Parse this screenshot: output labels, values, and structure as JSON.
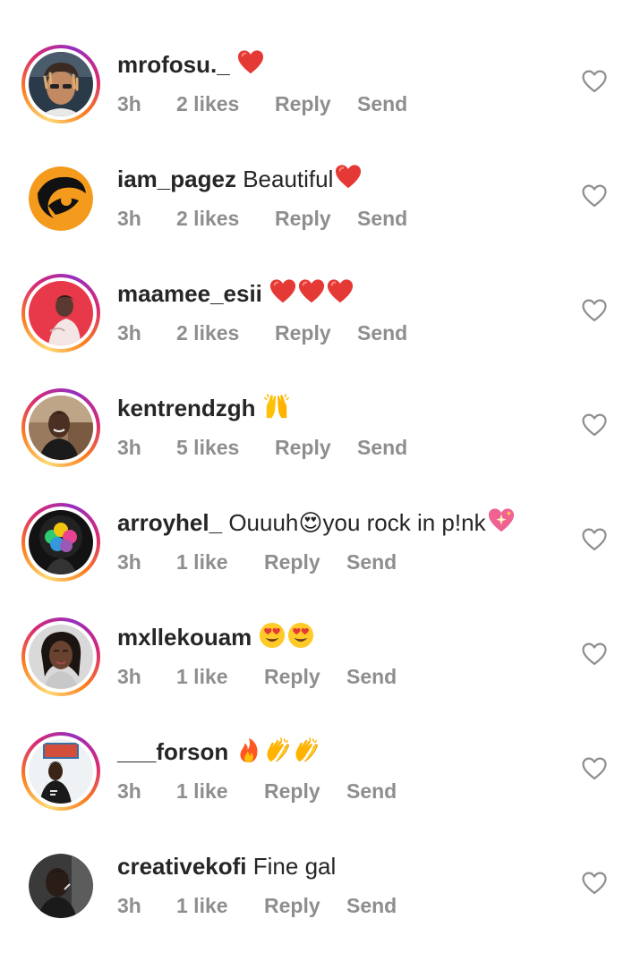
{
  "comments": [
    {
      "username": "mrofosu._",
      "text": "",
      "emojis": [
        "red-heart"
      ],
      "time": "3h",
      "likes": "2 likes",
      "reply": "Reply",
      "send": "Send",
      "avatar": "selfie-car",
      "ring": true
    },
    {
      "username": "iam_pagez",
      "text": "Beautiful",
      "emojis": [
        "red-heart"
      ],
      "time": "3h",
      "likes": "2 likes",
      "reply": "Reply",
      "send": "Send",
      "avatar": "orange-logo",
      "ring": false
    },
    {
      "username": "maamee_esii",
      "text": "",
      "emojis": [
        "red-heart",
        "red-heart",
        "red-heart"
      ],
      "time": "3h",
      "likes": "2 likes",
      "reply": "Reply",
      "send": "Send",
      "avatar": "red-portrait",
      "ring": true
    },
    {
      "username": "kentrendzgh",
      "text": "",
      "emojis": [
        "raising-hands"
      ],
      "time": "3h",
      "likes": "5 likes",
      "reply": "Reply",
      "send": "Send",
      "avatar": "man-portrait",
      "ring": true
    },
    {
      "username": "arroyhel_",
      "text": "Ouuuh😍you rock in p!nk",
      "emojis": [
        "sparkling-heart"
      ],
      "time": "3h",
      "likes": "1 like",
      "reply": "Reply",
      "send": "Send",
      "avatar": "rainbow-hair",
      "ring": true
    },
    {
      "username": "mxllekouam",
      "text": "",
      "emojis": [
        "heart-eyes",
        "heart-eyes"
      ],
      "time": "3h",
      "likes": "1 like",
      "reply": "Reply",
      "send": "Send",
      "avatar": "woman-portrait",
      "ring": true
    },
    {
      "username": "___forson",
      "text": "",
      "emojis": [
        "fire",
        "clapping-hands",
        "clapping-hands"
      ],
      "time": "3h",
      "likes": "1 like",
      "reply": "Reply",
      "send": "Send",
      "avatar": "man-room",
      "ring": true
    },
    {
      "username": "creativekofi",
      "text": "Fine gal",
      "emojis": [],
      "time": "3h",
      "likes": "1 like",
      "reply": "Reply",
      "send": "Send",
      "avatar": "dark-portrait",
      "ring": false
    }
  ],
  "colors": {
    "username": "#262626",
    "meta": "#8e8e8e",
    "heart_outline": "#8e8e8e"
  }
}
